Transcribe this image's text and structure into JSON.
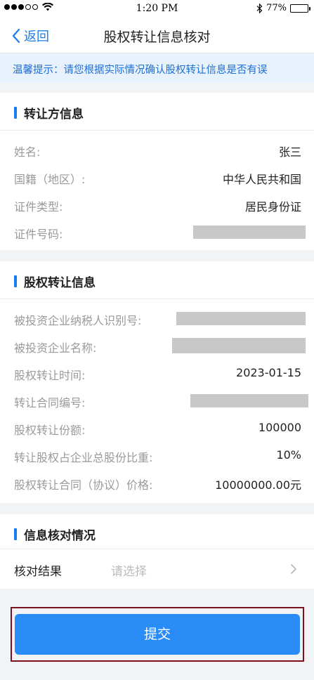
{
  "status_bar": {
    "time": "1:20 PM",
    "battery": "77%",
    "battery_level": 0.77
  },
  "nav": {
    "back_label": "返回",
    "title": "股权转让信息核对"
  },
  "tip": "温馨提示：请您根据实际情况确认股权转让信息是否有误",
  "transferor": {
    "title": "转让方信息",
    "rows": [
      {
        "label": "姓名:",
        "value": "张三"
      },
      {
        "label": "国籍（地区）:",
        "value": "中华人民共和国"
      },
      {
        "label": "证件类型:",
        "value": "居民身份证"
      },
      {
        "label": "证件号码:",
        "value": ""
      }
    ]
  },
  "equity": {
    "title": "股权转让信息",
    "rows": [
      {
        "label": "被投资企业纳税人识别号:",
        "value": ""
      },
      {
        "label": "被投资企业名称:",
        "value": ""
      },
      {
        "label": "股权转让时间:",
        "value": "2023-01-15"
      },
      {
        "label": "转让合同编号:",
        "value": ""
      },
      {
        "label": "股权转让份额:",
        "value": "100000"
      },
      {
        "label": "转让股权占企业总股份比重:",
        "value": "10%"
      },
      {
        "label": "股权转让合同（协议）价格:",
        "value": "10000000.00元"
      }
    ]
  },
  "verification": {
    "title": "信息核对情况",
    "result_label": "核对结果",
    "result_placeholder": "请选择"
  },
  "submit_label": "提交",
  "colors": {
    "accent": "#1a7cf0",
    "button": "#2a8cf7",
    "tip_bg": "#e8f2fd",
    "highlight_border": "#7a1020"
  }
}
